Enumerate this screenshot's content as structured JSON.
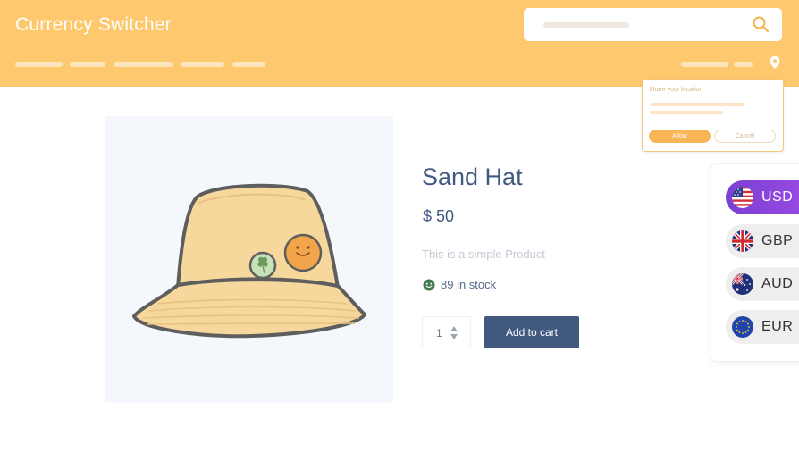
{
  "header": {
    "site_title": "Currency Switcher",
    "background": "#fec86e"
  },
  "location_popup": {
    "title": "Share your location",
    "allow_label": "Allow",
    "cancel_label": "Cancel"
  },
  "product": {
    "title": "Sand Hat",
    "price": "$ 50",
    "description": "This is a simple Product",
    "stock": "89 in stock",
    "quantity": "1",
    "add_to_cart_label": "Add to cart"
  },
  "currency_switcher": {
    "active_color": "#8a45dc",
    "items": [
      {
        "code": "USD",
        "flag": "us-flag-icon",
        "active": true
      },
      {
        "code": "GBP",
        "flag": "uk-flag-icon",
        "active": false
      },
      {
        "code": "AUD",
        "flag": "au-flag-icon",
        "active": false
      },
      {
        "code": "EUR",
        "flag": "eu-flag-icon",
        "active": false
      }
    ]
  }
}
